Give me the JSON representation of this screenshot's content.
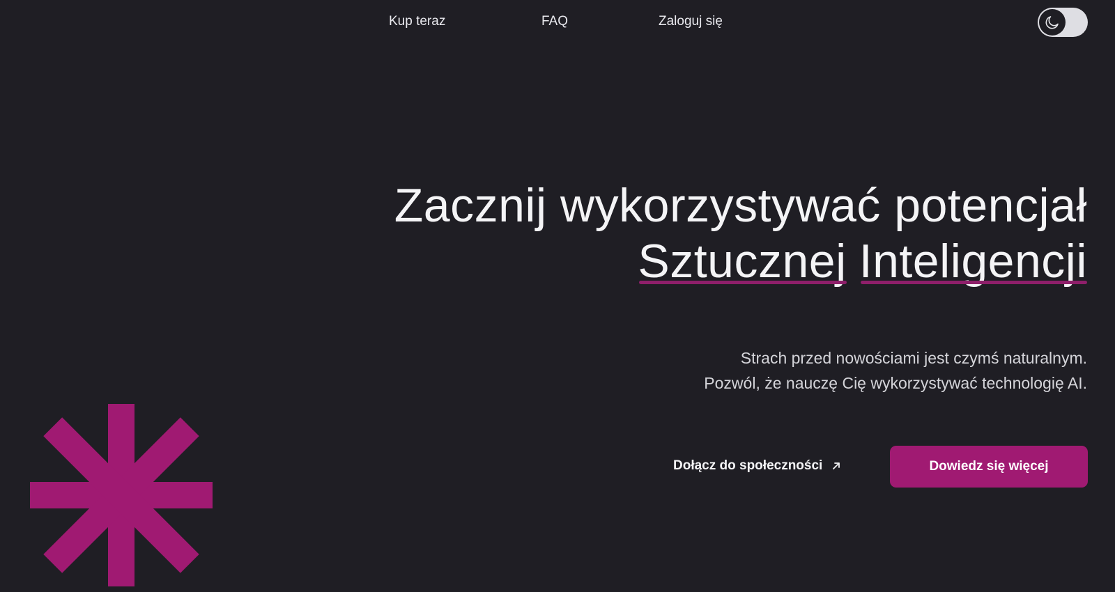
{
  "nav": {
    "items": [
      {
        "label": "Kup teraz"
      },
      {
        "label": "FAQ"
      },
      {
        "label": "Zaloguj się"
      }
    ],
    "theme_toggle_icon": "moon-icon"
  },
  "hero": {
    "title_line1": "Zacznij wykorzystywać potencjał",
    "title_word1": "Sztucznej",
    "title_word2": "Inteligencji",
    "subtitle_line1": "Strach przed nowościami jest czymś naturalnym.",
    "subtitle_line2": "Pozwól, że nauczę Cię wykorzystywać technologię AI.",
    "community_link": "Dołącz do społeczności",
    "community_icon": "arrow-up-right-icon",
    "cta_label": "Dowiedz się więcej"
  },
  "decor": {
    "icon": "asterisk-icon"
  },
  "colors": {
    "background": "#1f1e24",
    "accent": "#a01a72",
    "underline": "#8e1f6a",
    "text": "#f4f4f6"
  }
}
